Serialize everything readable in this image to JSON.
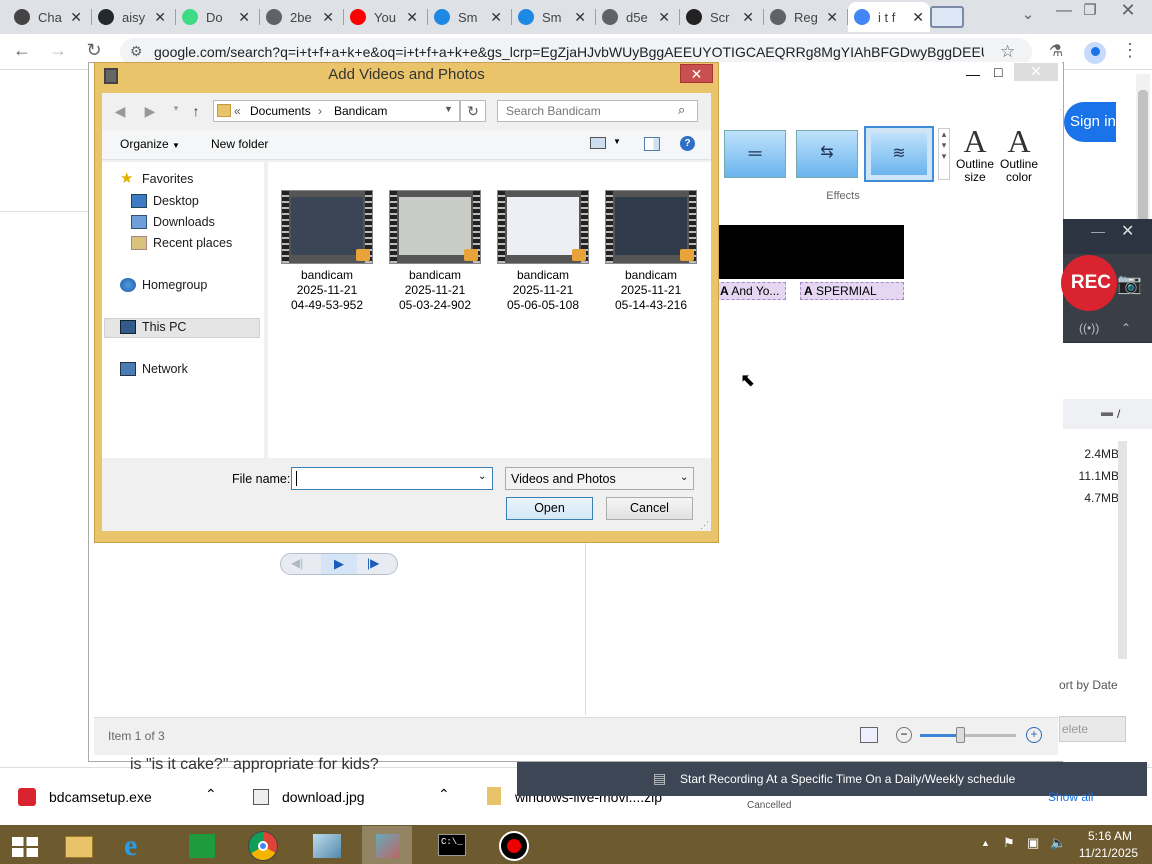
{
  "browser": {
    "tabs": [
      {
        "label": "Cha",
        "color": "#444"
      },
      {
        "label": "aisy",
        "color": "#24292e"
      },
      {
        "label": "Do",
        "color": "#3ddc84"
      },
      {
        "label": "2be",
        "color": "#5f6368"
      },
      {
        "label": "You",
        "color": "#ff0000"
      },
      {
        "label": "Sm",
        "color": "#1e88e5"
      },
      {
        "label": "Sm",
        "color": "#1e88e5"
      },
      {
        "label": "d5e",
        "color": "#5f6368"
      },
      {
        "label": "Scr",
        "color": "#222"
      },
      {
        "label": "Reg",
        "color": "#5f6368"
      },
      {
        "label": "i t f",
        "color": "#4285f4"
      }
    ],
    "url": "google.com/search?q=i+t+f+a+k+e&oq=i+t+f+a+k+e&gs_lcrp=EgZjaHJvbWUyBggAEEUYOTIGCAEQRRg8MgYIAhBFGDwyBggDEEU..."
  },
  "bg_app": {
    "sign_in_label": "Sign in",
    "ribbon": {
      "outline_size": "Outline size",
      "outline_color": "Outline color",
      "group_label": "Effects"
    },
    "captions": [
      "And Yo...",
      "SPERMIAL"
    ],
    "status_text": "Item 1 of 3",
    "bg_text": "is \"is it cake?\" appropriate for kids?"
  },
  "bandicam": {
    "rec_label": "REC",
    "sizes": [
      "2.4MB",
      "11.1MB",
      "4.7MB"
    ],
    "sort_label": "ort by Date",
    "delete_label": "elete",
    "path_sep": "/"
  },
  "dialog": {
    "title": "Add Videos and Photos",
    "breadcrumb": [
      "Documents",
      "Bandicam"
    ],
    "search_placeholder": "Search Bandicam",
    "organize_label": "Organize",
    "new_folder_label": "New folder",
    "nav": {
      "favorites": "Favorites",
      "desktop": "Desktop",
      "downloads": "Downloads",
      "recent": "Recent places",
      "homegroup": "Homegroup",
      "thispc": "This PC",
      "network": "Network"
    },
    "files": [
      {
        "name": "bandicam",
        "date": "2025-11-21",
        "time": "04-49-53-952",
        "color": "#3a4656"
      },
      {
        "name": "bandicam",
        "date": "2025-11-21",
        "time": "05-03-24-902",
        "color": "#c9cbc6"
      },
      {
        "name": "bandicam",
        "date": "2025-11-21",
        "time": "05-06-05-108",
        "color": "#eceff3"
      },
      {
        "name": "bandicam",
        "date": "2025-11-21",
        "time": "05-14-43-216",
        "color": "#2f3a4a"
      }
    ],
    "filename_label": "File name:",
    "filename_value": "",
    "filetype": "Videos and Photos",
    "open_label": "Open",
    "cancel_label": "Cancel"
  },
  "downloads": [
    {
      "name": "bdcamsetup.exe"
    },
    {
      "name": "download.jpg"
    },
    {
      "name": "windows-live-movi....zip"
    }
  ],
  "notification": {
    "text": "Start Recording At a Specific Time On a Daily/Weekly schedule",
    "status": "Cancelled",
    "show_all": "Show all"
  },
  "taskbar": {
    "time": "5:16 AM",
    "date": "11/21/2025"
  }
}
